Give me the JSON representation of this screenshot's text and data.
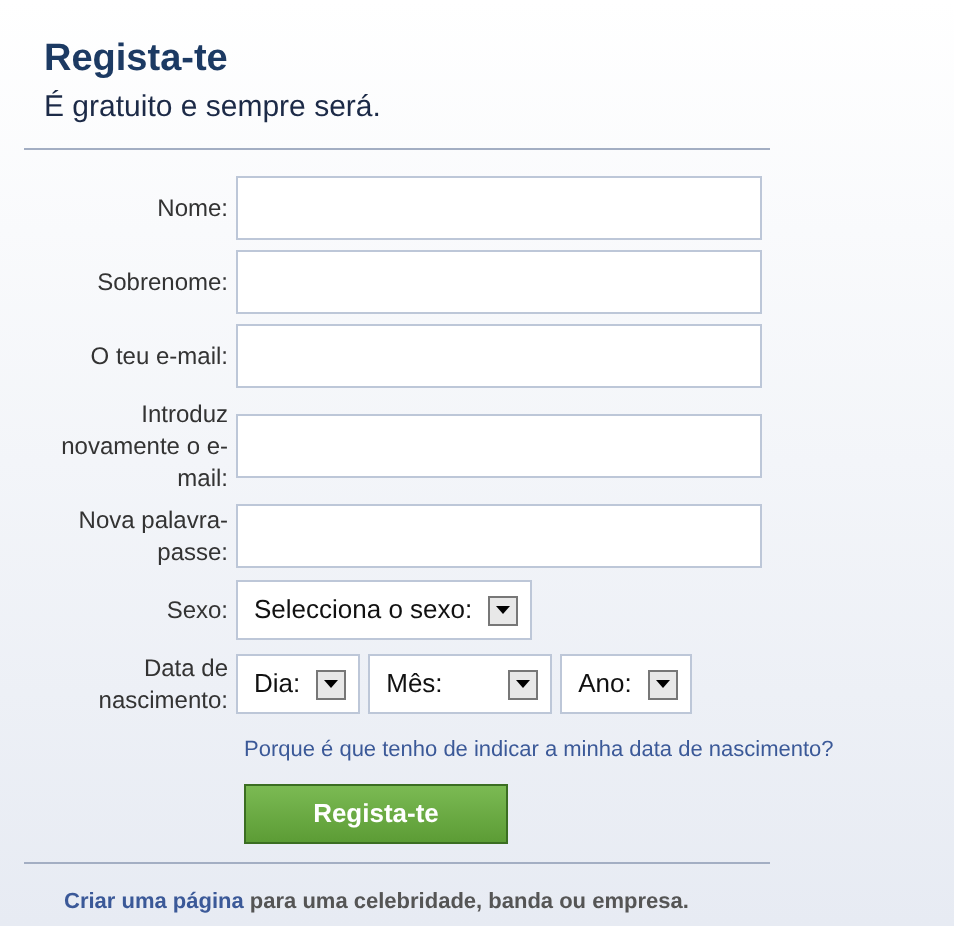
{
  "header": {
    "title": "Regista-te",
    "subtitle": "É gratuito e sempre será."
  },
  "fields": [
    {
      "kind": "text",
      "label": "Nome:"
    },
    {
      "kind": "text",
      "label": "Sobrenome:"
    },
    {
      "kind": "text",
      "label": "O teu e-mail:"
    },
    {
      "kind": "text",
      "label": "Introduz novamente o e-mail:"
    },
    {
      "kind": "text",
      "label": "Nova palavra-passe:"
    },
    {
      "kind": "select",
      "label": "Sexo:",
      "selects": [
        {
          "value": "Selecciona o sexo:"
        }
      ]
    },
    {
      "kind": "select",
      "label": "Data de nascimento:",
      "selects": [
        {
          "value": "Dia:"
        },
        {
          "value": "Mês:"
        },
        {
          "value": "Ano:"
        }
      ]
    }
  ],
  "birthday_help_link": "Porque é que tenho de indicar a minha data de nascimento?",
  "submit_button": "Regista-te",
  "footer": {
    "link": "Criar uma página",
    "text": "para uma celebridade, banda ou empresa."
  }
}
